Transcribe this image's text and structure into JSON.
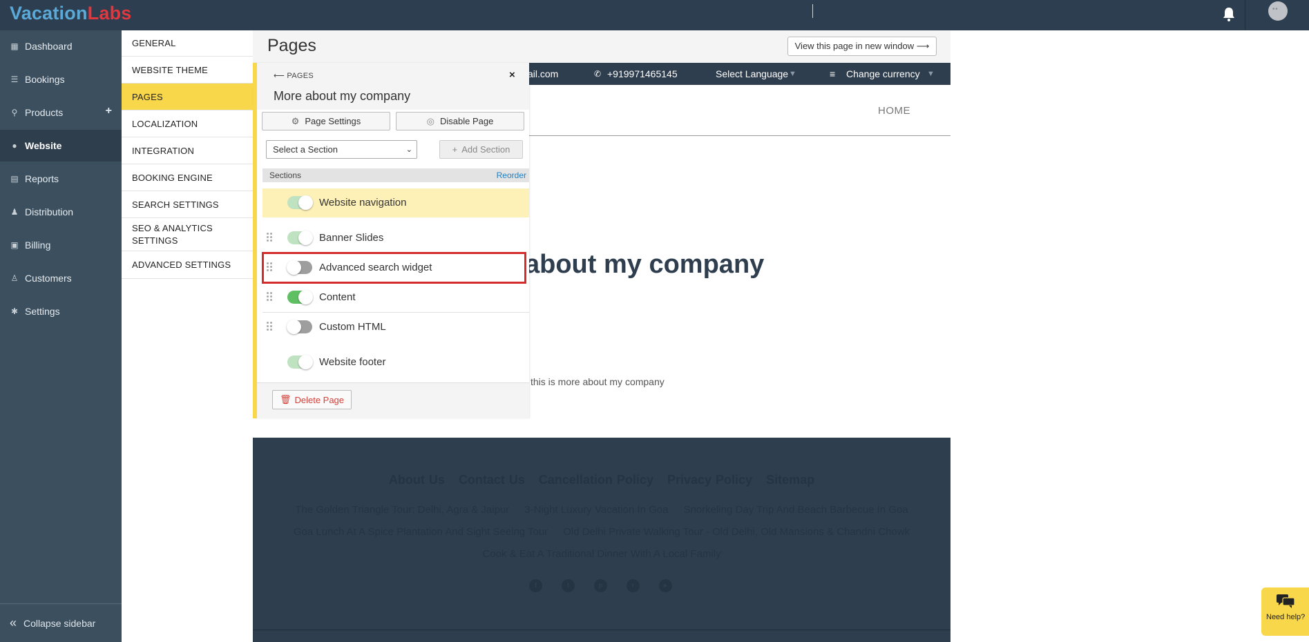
{
  "brand": {
    "part1": "Vacation",
    "part2": "Labs"
  },
  "sidebar": {
    "items": [
      {
        "label": "Dashboard",
        "icon": "calendar-icon"
      },
      {
        "label": "Bookings",
        "icon": "list-icon"
      },
      {
        "label": "Products",
        "icon": "map-pin-icon"
      },
      {
        "label": "Website",
        "icon": "globe-icon"
      },
      {
        "label": "Reports",
        "icon": "report-icon"
      },
      {
        "label": "Distribution",
        "icon": "users-icon"
      },
      {
        "label": "Billing",
        "icon": "money-icon"
      },
      {
        "label": "Customers",
        "icon": "user-icon"
      },
      {
        "label": "Settings",
        "icon": "gear-icon"
      }
    ],
    "collapse_label": "Collapse sidebar"
  },
  "submenu": {
    "items": [
      "GENERAL",
      "WEBSITE THEME",
      "PAGES",
      "LOCALIZATION",
      "INTEGRATION",
      "BOOKING ENGINE",
      "SEARCH SETTINGS",
      "SEO & ANALYTICS SETTINGS",
      "ADVANCED SETTINGS"
    ],
    "active": "PAGES"
  },
  "page": {
    "title": "Pages",
    "view_button": "View this page in new window ⟶"
  },
  "preview": {
    "email_fragment": "ail.com",
    "phone": "+919971465145",
    "language": "Select Language",
    "currency": "Change currency",
    "nav_home": "HOME",
    "heading": "about my company",
    "body": "this is more about my company",
    "footer_links": [
      "About Us",
      "Contact Us",
      "Cancellation Policy",
      "Privacy Policy",
      "Sitemap"
    ],
    "footer_tours_line1": [
      "The Golden Triangle Tour: Delhi, Agra & Jaipur",
      "3-Night Luxury Vacation In Goa",
      "Snorkeling Day Trip And Beach Barbecue In Goa"
    ],
    "footer_tours_line2": [
      "Goa Lunch At A Spice Plantation And Sight Seeing Tour",
      "Old Delhi Private Walking Tour - Old Delhi, Old Mansions & Chandni Chowk"
    ],
    "footer_tours_line3": [
      "Cook & Eat A Traditional Dinner With A Local Family"
    ],
    "social_icons": [
      "facebook-icon",
      "twitter-icon",
      "pinterest-icon",
      "rss-icon",
      "youtube-icon"
    ]
  },
  "panel": {
    "back_label": "⟵ PAGES",
    "title": "More about my company",
    "page_settings": "Page Settings",
    "disable_page": "Disable Page",
    "select_section": "Select a Section",
    "add_section": "Add Section",
    "sections_label": "Sections",
    "reorder": "Reorder",
    "sections": [
      {
        "label": "Website navigation",
        "state": "on-locked"
      },
      {
        "label": "Banner Slides",
        "state": "on-locked"
      },
      {
        "label": "Advanced search widget",
        "state": "off"
      },
      {
        "label": "Content",
        "state": "on"
      },
      {
        "label": "Custom HTML",
        "state": "off"
      },
      {
        "label": "Website footer",
        "state": "on-locked"
      }
    ],
    "delete_page": "Delete Page"
  },
  "help": {
    "label": "Need help?"
  },
  "colors": {
    "topbar": "#2c3e50",
    "sidebar": "#3c4f5f",
    "accent": "#f9d74a",
    "highlight": "#d42b2b",
    "toggle_on": "#5fbf63"
  }
}
